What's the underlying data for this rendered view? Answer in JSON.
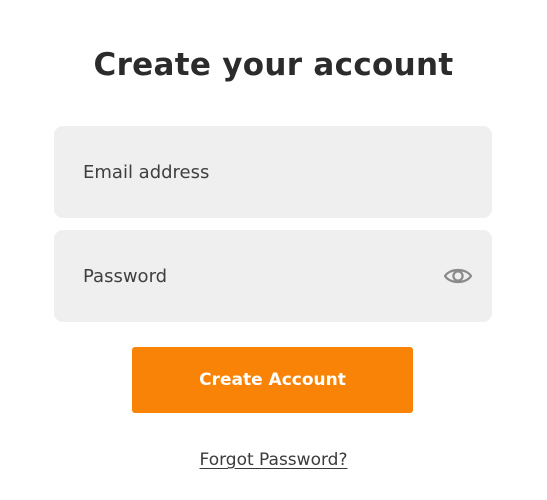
{
  "page": {
    "title": "Create your account"
  },
  "form": {
    "email": {
      "placeholder": "Email address",
      "value": ""
    },
    "password": {
      "placeholder": "Password",
      "value": "",
      "toggle_icon": "eye-icon"
    },
    "submit_label": "Create Account",
    "forgot_link": "Forgot Password?"
  },
  "colors": {
    "accent": "#f98307",
    "field_background": "#efefef",
    "text": "#2b2b2b",
    "icon": "#8a8a8a"
  }
}
